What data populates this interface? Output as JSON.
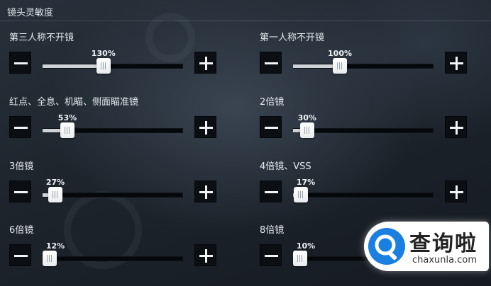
{
  "header": {
    "title": "镜头灵敏度"
  },
  "settings": [
    {
      "label": "第三人称不开镜",
      "value": 130,
      "display": "130%",
      "max": 300
    },
    {
      "label": "第一人称不开镜",
      "value": 100,
      "display": "100%",
      "max": 300
    },
    {
      "label": "红点、全息、机瞄、侧面瞄准镜",
      "value": 53,
      "display": "53%",
      "max": 300
    },
    {
      "label": "2倍镜",
      "value": 30,
      "display": "30%",
      "max": 300
    },
    {
      "label": "3倍镜",
      "value": 27,
      "display": "27%",
      "max": 300
    },
    {
      "label": "4倍镜、VSS",
      "value": 17,
      "display": "17%",
      "max": 300
    },
    {
      "label": "6倍镜",
      "value": 12,
      "display": "12%",
      "max": 300
    },
    {
      "label": "8倍镜",
      "value": 10,
      "display": "10%",
      "max": 300
    }
  ],
  "buttons": {
    "minus_icon": "minus-icon",
    "plus_icon": "plus-icon"
  },
  "watermark": {
    "name": "查询啦",
    "domain": "chaxunla.com",
    "brand_color": "#1a7fe0"
  },
  "colors": {
    "track": "#05080b",
    "fill": "#cfd3d8",
    "button_bg": "#0b0e12"
  }
}
